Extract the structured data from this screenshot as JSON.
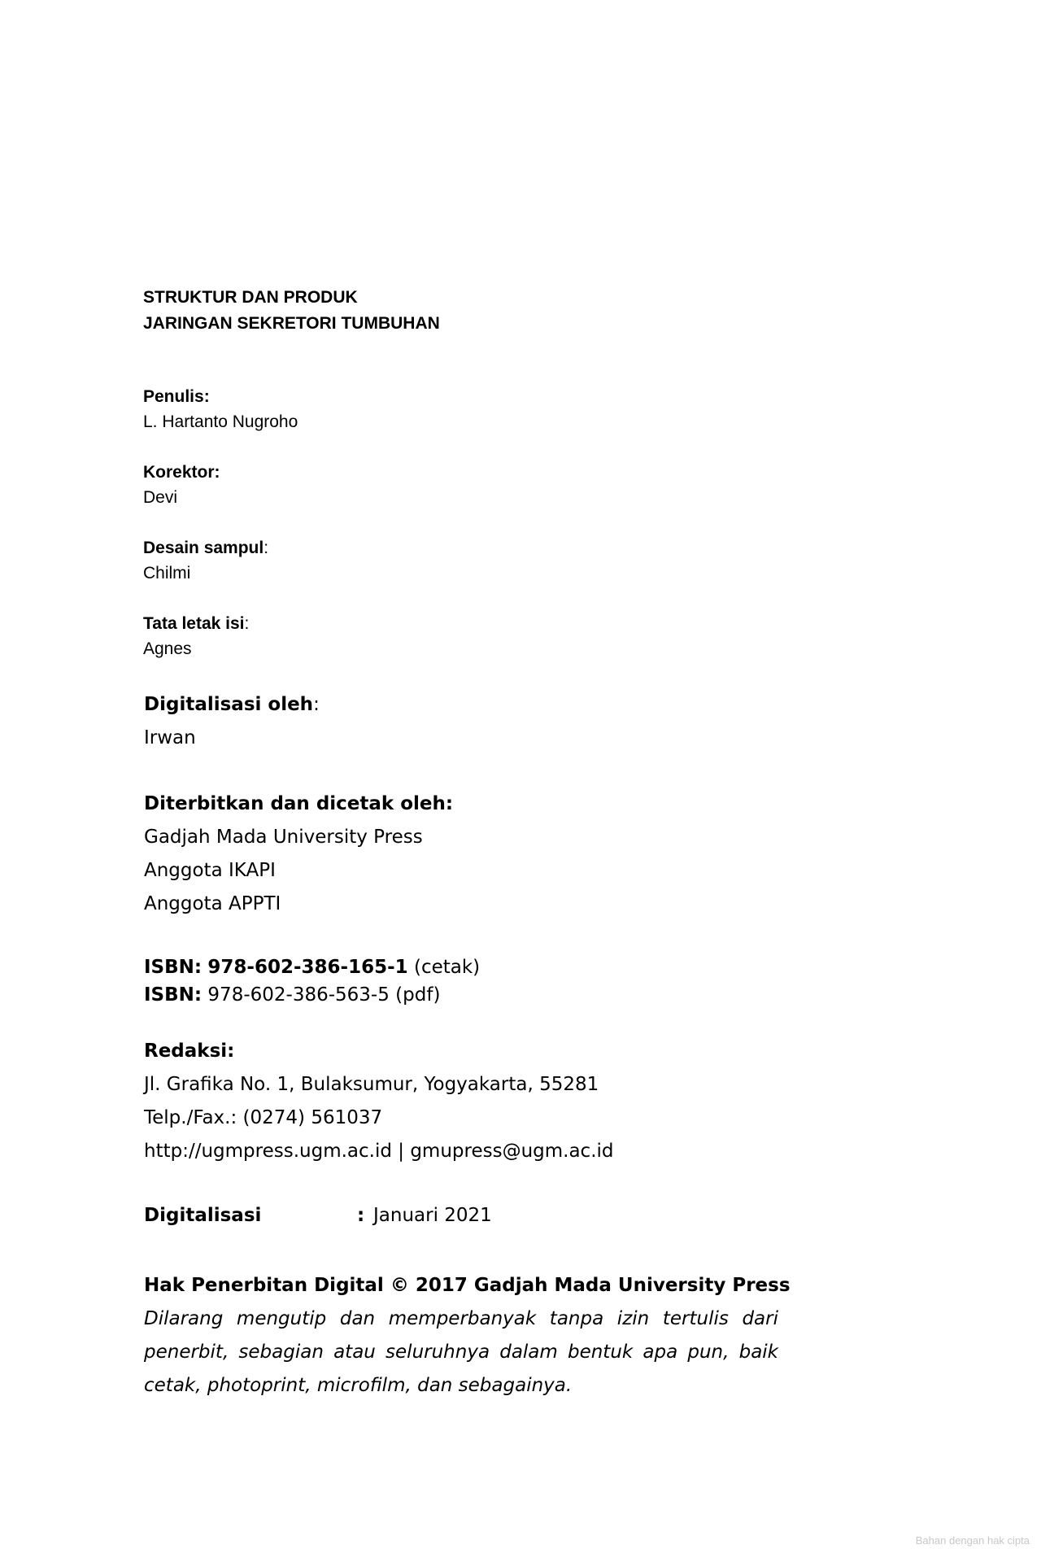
{
  "title": {
    "line1": "STRUKTUR DAN PRODUK",
    "line2": "JARINGAN SEKRETORI TUMBUHAN"
  },
  "credits": {
    "penulis": {
      "label": "Penulis:",
      "value": "L. Hartanto Nugroho"
    },
    "korektor": {
      "label": "Korektor:",
      "value": "Devi"
    },
    "desain_sampul": {
      "label": "Desain sampul",
      "colon": ":",
      "value": "Chilmi"
    },
    "tata_letak": {
      "label": "Tata letak isi",
      "colon": ":",
      "value": "Agnes"
    },
    "digitalisasi_oleh": {
      "label": "Digitalisasi oleh",
      "colon": ":",
      "value": "Irwan"
    }
  },
  "publisher": {
    "label": "Diterbitkan dan dicetak oleh:",
    "lines": [
      "Gadjah Mada University Press",
      "Anggota IKAPI",
      "Anggota APPTI"
    ]
  },
  "isbn": {
    "print": {
      "label": "ISBN:",
      "number": "978-602-386-165-1",
      "suffix": "(cetak)"
    },
    "pdf": {
      "label": "ISBN:",
      "number": "978-602-386-563-5",
      "suffix": "(pdf)"
    }
  },
  "redaksi": {
    "label": "Redaksi:",
    "lines": [
      "Jl. Grafika No. 1, Bulaksumur, Yogyakarta, 55281",
      "Telp./Fax.: (0274) 561037",
      "http://ugmpress.ugm.ac.id | gmupress@ugm.ac.id"
    ]
  },
  "digitalisasi": {
    "label": "Digitalisasi",
    "separator": ":",
    "value": "Januari 2021"
  },
  "rights": {
    "heading": "Hak Penerbitan Digital © 2017 Gadjah Mada University Press",
    "notice": "Dilarang mengutip dan memperbanyak tanpa izin tertulis dari penerbit, sebagian atau seluruhnya dalam bentuk apa pun, baik cetak, photoprint, microfilm, dan sebagainya."
  },
  "watermark": "Bahan dengan hak cipta"
}
